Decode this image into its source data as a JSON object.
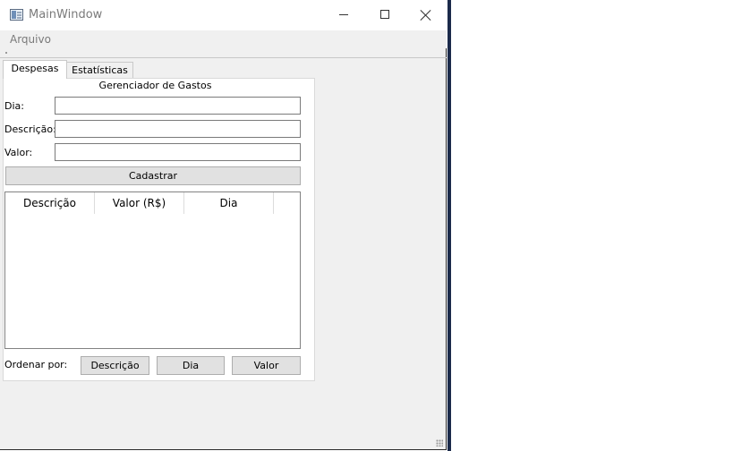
{
  "window": {
    "title": "MainWindow",
    "minimize_label": "",
    "maximize_label": "",
    "close_label": ""
  },
  "menu": {
    "items": [
      {
        "label": "Arquivo"
      }
    ]
  },
  "tabs": [
    {
      "label": "Despesas",
      "active": true
    },
    {
      "label": "Estatísticas",
      "active": false
    }
  ],
  "form": {
    "title": "Gerenciador de Gastos",
    "dia_label": "Dia:",
    "dia_value": "",
    "descricao_label": "Descrição:",
    "descricao_value": "",
    "valor_label": "Valor:",
    "valor_value": "",
    "submit_label": "Cadastrar"
  },
  "table": {
    "columns": [
      "Descrição",
      "Valor (R$)",
      "Dia"
    ],
    "rows": []
  },
  "sort": {
    "label": "Ordenar por:",
    "buttons": [
      "Descrição",
      "Dia",
      "Valor"
    ]
  },
  "icons": {
    "app": "app-window-icon",
    "minimize": "minimize-icon",
    "maximize": "maximize-icon",
    "close": "close-icon",
    "resize": "resize-grip-icon"
  }
}
